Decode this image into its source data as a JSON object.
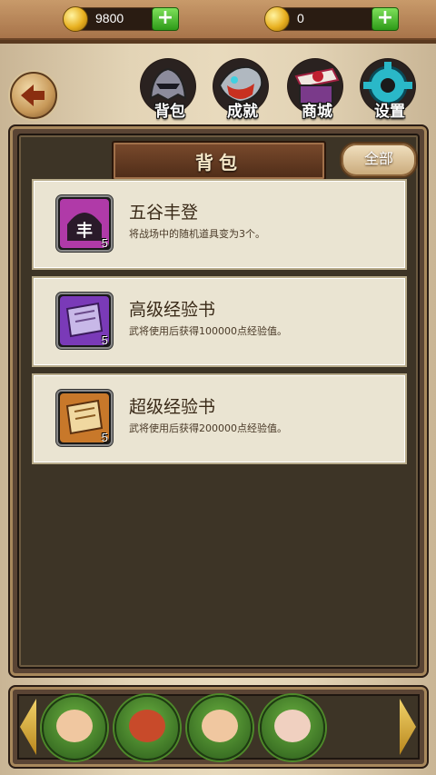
{
  "resources": {
    "gold": {
      "value": "9800",
      "icon": "gold-ingot-icon"
    },
    "coin": {
      "value": "0",
      "icon": "coin-icon"
    }
  },
  "nav": {
    "tabs": [
      {
        "label": "背包",
        "icon": "backpack-helmet-icon"
      },
      {
        "label": "成就",
        "icon": "achievement-mask-icon"
      },
      {
        "label": "商城",
        "icon": "shop-chest-icon"
      },
      {
        "label": "设置",
        "icon": "settings-gear-icon"
      }
    ]
  },
  "panel": {
    "title": "背包",
    "filter_label": "全部"
  },
  "items": [
    {
      "name": "五谷丰登",
      "desc": "将战场中的随机道具变为3个。",
      "count": "5",
      "icon_glyph": "丰",
      "color": "#b03aa8"
    },
    {
      "name": "高级经验书",
      "desc": "武将使用后获得100000点经验值。",
      "count": "5",
      "color": "#7a3ab8"
    },
    {
      "name": "超级经验书",
      "desc": "武将使用后获得200000点经验值。",
      "count": "5",
      "color": "#c8782a"
    }
  ],
  "heroes": [
    {
      "icon": "hero-portrait-1-icon"
    },
    {
      "icon": "hero-portrait-2-icon"
    },
    {
      "icon": "hero-portrait-3-icon"
    },
    {
      "icon": "hero-portrait-4-icon"
    }
  ],
  "colors": {
    "accent_green": "#3aa820",
    "panel_dark": "#3d3426",
    "card_bg": "#eae4d2"
  }
}
